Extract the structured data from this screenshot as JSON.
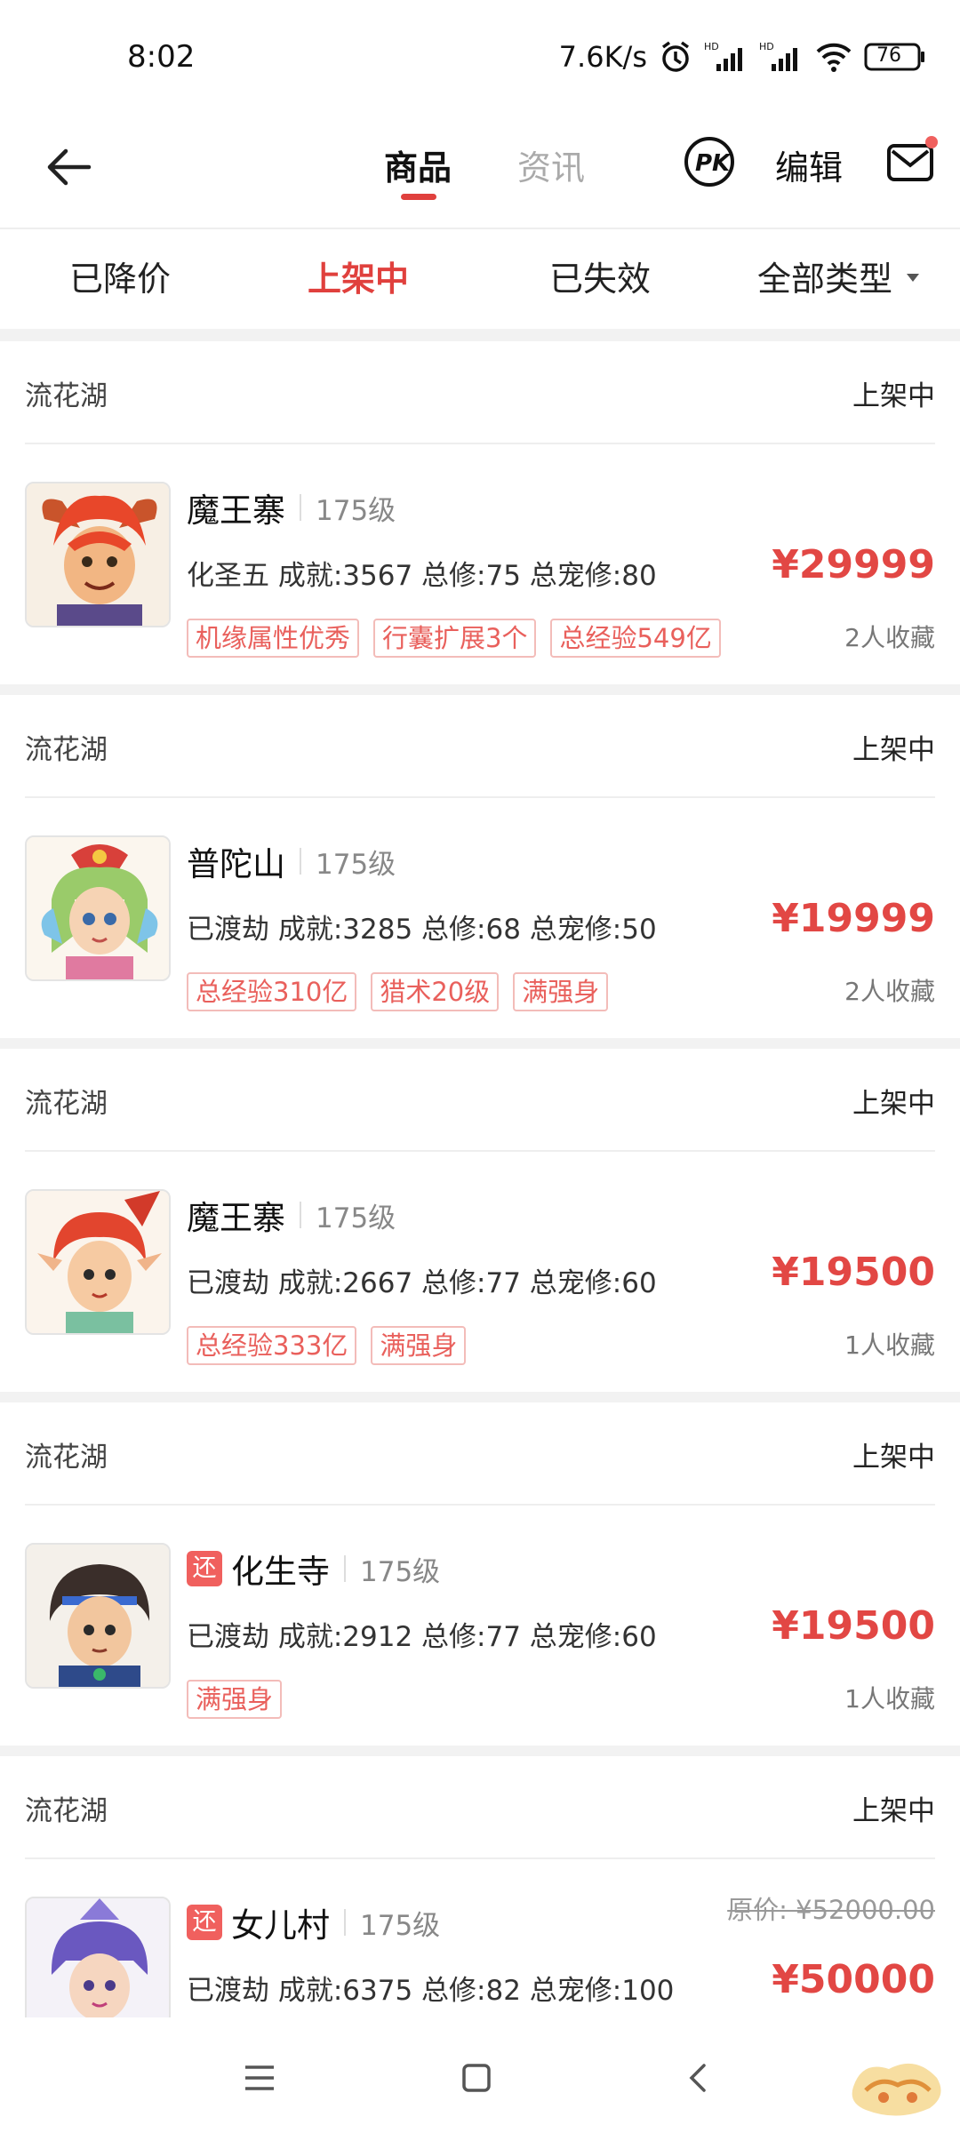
{
  "status_bar": {
    "time": "8:02",
    "net_speed": "7.6K/s",
    "battery": "76"
  },
  "header": {
    "tabs": [
      {
        "label": "商品"
      },
      {
        "label": "资讯"
      }
    ],
    "edit_label": "编辑"
  },
  "filters": [
    {
      "label": "已降价"
    },
    {
      "label": "上架中"
    },
    {
      "label": "已失效"
    },
    {
      "label": "全部类型"
    }
  ],
  "listings": [
    {
      "server": "流花湖",
      "status": "上架中",
      "returned": false,
      "returned_label": "",
      "school": "魔王寨",
      "level": "175级",
      "detail": "化圣五 成就:3567 总修:75 总宠修:80",
      "tags": [
        "机缘属性优秀",
        "行囊扩展3个",
        "总经验549亿"
      ],
      "price": "¥29999",
      "original_price": "",
      "favorites": "2人收藏",
      "avatar": "demon-king-red-hair"
    },
    {
      "server": "流花湖",
      "status": "上架中",
      "returned": false,
      "returned_label": "",
      "school": "普陀山",
      "level": "175级",
      "detail": "已渡劫 成就:3285 总修:68 总宠修:50",
      "tags": [
        "总经验310亿",
        "猎术20级",
        "满强身"
      ],
      "price": "¥19999",
      "original_price": "",
      "favorites": "2人收藏",
      "avatar": "putuo-green-hair"
    },
    {
      "server": "流花湖",
      "status": "上架中",
      "returned": false,
      "returned_label": "",
      "school": "魔王寨",
      "level": "175级",
      "detail": "已渡劫 成就:2667 总修:77 总宠修:60",
      "tags": [
        "总经验333亿",
        "满强身"
      ],
      "price": "¥19500",
      "original_price": "",
      "favorites": "1人收藏",
      "avatar": "red-hair-girl"
    },
    {
      "server": "流花湖",
      "status": "上架中",
      "returned": true,
      "returned_label": "还",
      "school": "化生寺",
      "level": "175级",
      "detail": "已渡劫 成就:2912 总修:77 总宠修:60",
      "tags": [
        "满强身"
      ],
      "price": "¥19500",
      "original_price": "",
      "favorites": "1人收藏",
      "avatar": "dark-hair-boy"
    },
    {
      "server": "流花湖",
      "status": "上架中",
      "returned": true,
      "returned_label": "还",
      "school": "女儿村",
      "level": "175级",
      "detail": "已渡劫 成就:6375 总修:82 总宠修:100",
      "tags": [],
      "price": "¥50000",
      "original_price": "原价: ¥52000.00",
      "favorites": "",
      "avatar": "purple-armor-girl"
    }
  ],
  "colors": {
    "accent": "#e0403d",
    "price": "#e24744",
    "tag_text": "#e9605c",
    "tag_border": "#f3bcb9"
  }
}
